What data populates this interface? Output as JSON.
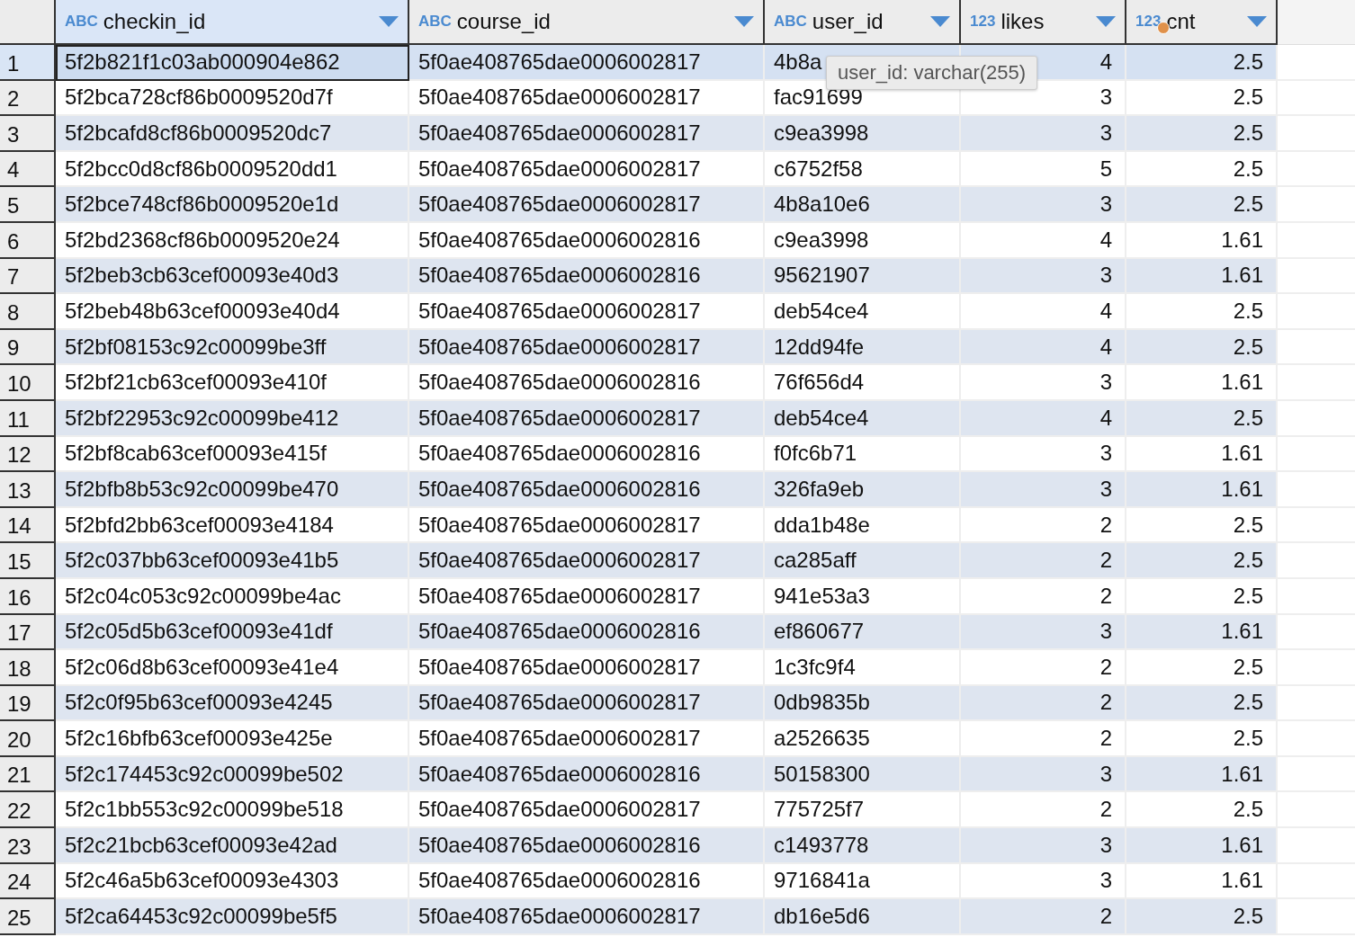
{
  "table": {
    "columns": [
      {
        "type_label": "ABC",
        "name": "checkin_id",
        "kind": "text",
        "selected": true,
        "badge": false
      },
      {
        "type_label": "ABC",
        "name": "course_id",
        "kind": "text",
        "selected": false,
        "badge": false
      },
      {
        "type_label": "ABC",
        "name": "user_id",
        "kind": "text",
        "selected": false,
        "badge": false
      },
      {
        "type_label": "123",
        "name": "likes",
        "kind": "number",
        "selected": false,
        "badge": false
      },
      {
        "type_label": "123",
        "name": "cnt",
        "kind": "number",
        "selected": false,
        "badge": true
      }
    ],
    "rows": [
      {
        "number": "1",
        "selected": true,
        "cells": [
          "5f2b821f1c03ab000904e862",
          "5f0ae408765dae0006002817",
          "4b8a",
          "4",
          "2.5"
        ]
      },
      {
        "number": "2",
        "selected": false,
        "cells": [
          "5f2bca728cf86b0009520d7f",
          "5f0ae408765dae0006002817",
          "fac91699",
          "3",
          "2.5"
        ]
      },
      {
        "number": "3",
        "selected": false,
        "cells": [
          "5f2bcafd8cf86b0009520dc7",
          "5f0ae408765dae0006002817",
          "c9ea3998",
          "3",
          "2.5"
        ]
      },
      {
        "number": "4",
        "selected": false,
        "cells": [
          "5f2bcc0d8cf86b0009520dd1",
          "5f0ae408765dae0006002817",
          "c6752f58",
          "5",
          "2.5"
        ]
      },
      {
        "number": "5",
        "selected": false,
        "cells": [
          "5f2bce748cf86b0009520e1d",
          "5f0ae408765dae0006002817",
          "4b8a10e6",
          "3",
          "2.5"
        ]
      },
      {
        "number": "6",
        "selected": false,
        "cells": [
          "5f2bd2368cf86b0009520e24",
          "5f0ae408765dae0006002816",
          "c9ea3998",
          "4",
          "1.61"
        ]
      },
      {
        "number": "7",
        "selected": false,
        "cells": [
          "5f2beb3cb63cef00093e40d3",
          "5f0ae408765dae0006002816",
          "95621907",
          "3",
          "1.61"
        ]
      },
      {
        "number": "8",
        "selected": false,
        "cells": [
          "5f2beb48b63cef00093e40d4",
          "5f0ae408765dae0006002817",
          "deb54ce4",
          "4",
          "2.5"
        ]
      },
      {
        "number": "9",
        "selected": false,
        "cells": [
          "5f2bf08153c92c00099be3ff",
          "5f0ae408765dae0006002817",
          "12dd94fe",
          "4",
          "2.5"
        ]
      },
      {
        "number": "10",
        "selected": false,
        "cells": [
          "5f2bf21cb63cef00093e410f",
          "5f0ae408765dae0006002816",
          "76f656d4",
          "3",
          "1.61"
        ]
      },
      {
        "number": "11",
        "selected": false,
        "cells": [
          "5f2bf22953c92c00099be412",
          "5f0ae408765dae0006002817",
          "deb54ce4",
          "4",
          "2.5"
        ]
      },
      {
        "number": "12",
        "selected": false,
        "cells": [
          "5f2bf8cab63cef00093e415f",
          "5f0ae408765dae0006002816",
          "f0fc6b71",
          "3",
          "1.61"
        ]
      },
      {
        "number": "13",
        "selected": false,
        "cells": [
          "5f2bfb8b53c92c00099be470",
          "5f0ae408765dae0006002816",
          "326fa9eb",
          "3",
          "1.61"
        ]
      },
      {
        "number": "14",
        "selected": false,
        "cells": [
          "5f2bfd2bb63cef00093e4184",
          "5f0ae408765dae0006002817",
          "dda1b48e",
          "2",
          "2.5"
        ]
      },
      {
        "number": "15",
        "selected": false,
        "cells": [
          "5f2c037bb63cef00093e41b5",
          "5f0ae408765dae0006002817",
          "ca285aff",
          "2",
          "2.5"
        ]
      },
      {
        "number": "16",
        "selected": false,
        "cells": [
          "5f2c04c053c92c00099be4ac",
          "5f0ae408765dae0006002817",
          "941e53a3",
          "2",
          "2.5"
        ]
      },
      {
        "number": "17",
        "selected": false,
        "cells": [
          "5f2c05d5b63cef00093e41df",
          "5f0ae408765dae0006002816",
          "ef860677",
          "3",
          "1.61"
        ]
      },
      {
        "number": "18",
        "selected": false,
        "cells": [
          "5f2c06d8b63cef00093e41e4",
          "5f0ae408765dae0006002817",
          "1c3fc9f4",
          "2",
          "2.5"
        ]
      },
      {
        "number": "19",
        "selected": false,
        "cells": [
          "5f2c0f95b63cef00093e4245",
          "5f0ae408765dae0006002817",
          "0db9835b",
          "2",
          "2.5"
        ]
      },
      {
        "number": "20",
        "selected": false,
        "cells": [
          "5f2c16bfb63cef00093e425e",
          "5f0ae408765dae0006002817",
          "a2526635",
          "2",
          "2.5"
        ]
      },
      {
        "number": "21",
        "selected": false,
        "cells": [
          "5f2c174453c92c00099be502",
          "5f0ae408765dae0006002816",
          "50158300",
          "3",
          "1.61"
        ]
      },
      {
        "number": "22",
        "selected": false,
        "cells": [
          "5f2c1bb553c92c00099be518",
          "5f0ae408765dae0006002817",
          "775725f7",
          "2",
          "2.5"
        ]
      },
      {
        "number": "23",
        "selected": false,
        "cells": [
          "5f2c21bcb63cef00093e42ad",
          "5f0ae408765dae0006002816",
          "c1493778",
          "3",
          "1.61"
        ]
      },
      {
        "number": "24",
        "selected": false,
        "cells": [
          "5f2c46a5b63cef00093e4303",
          "5f0ae408765dae0006002816",
          "9716841a",
          "3",
          "1.61"
        ]
      },
      {
        "number": "25",
        "selected": false,
        "cells": [
          "5f2ca64453c92c00099be5f5",
          "5f0ae408765dae0006002817",
          "db16e5d6",
          "2",
          "2.5"
        ]
      }
    ]
  },
  "tooltip": {
    "text": "user_id: varchar(255)"
  }
}
